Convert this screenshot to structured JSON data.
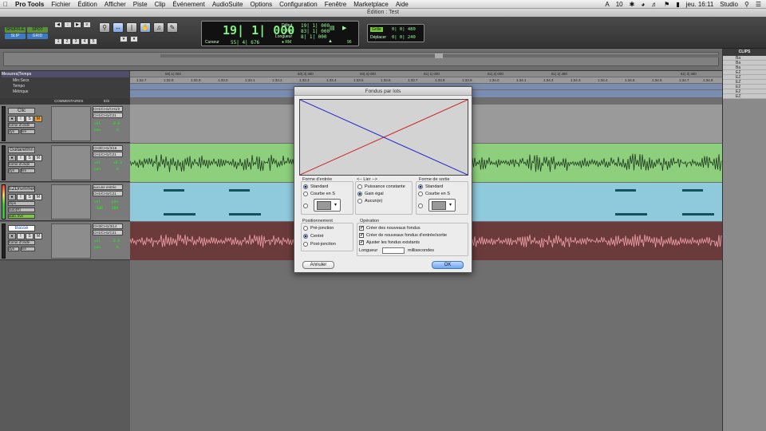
{
  "menubar": {
    "apple": "",
    "app": "Pro Tools",
    "items": [
      "Fichier",
      "Édition",
      "Afficher",
      "Piste",
      "Clip",
      "Événement",
      "AudioSuite",
      "Options",
      "Configuration",
      "Fenêtre",
      "Marketplace",
      "Aide"
    ],
    "status_num": "10",
    "clock": "jeu. 16:11",
    "user": "Studio"
  },
  "window": {
    "title": "Édition : Test"
  },
  "toolbar": {
    "modes": [
      "SHUFFLE",
      "SPOT",
      "SLIP",
      "GRID"
    ],
    "numbers": [
      "1",
      "2",
      "3",
      "4",
      "5"
    ],
    "counter": {
      "main": "19| 1| 000",
      "cursor_label": "Curseur",
      "cursor_val": "55| 4| 676",
      "start_label": "Début",
      "start_val": "19| 1| 000",
      "end_label": "Fin",
      "end_val": "83| 1| 000",
      "length_label": "Longueur",
      "length_val": "8| 1| 000",
      "tempo": "96"
    },
    "grid": {
      "grid_label": "Grille",
      "grid_val": "0| 0| 480",
      "nudge_label": "Déplacer",
      "nudge_val": "0| 0| 240"
    }
  },
  "rulers": {
    "labels": [
      "Mesures|Temps",
      "Min:Secs",
      "Tempo",
      "Métrique"
    ],
    "bar_ticks": [
      "50| 1| 000",
      "50| 3| 480",
      "50| 4| 000",
      "51| 1| 000",
      "51| 2| 000",
      "51| 2| 480",
      "51| 3| 480"
    ],
    "time_ticks": [
      "1:32.7",
      "1:32.8",
      "1:32.9",
      "1:33.0",
      "1:33.1",
      "1:33.2",
      "1:33.3",
      "1:33.4",
      "1:33.5",
      "1:33.6",
      "1:33.7",
      "1:33.8",
      "1:33.9",
      "1:34.0",
      "1:34.1",
      "1:34.2",
      "1:34.3",
      "1:34.4",
      "1:34.5",
      "1:34.6",
      "1:34.7",
      "1:34.8"
    ]
  },
  "columns": {
    "comments": "COMMENTAIRES",
    "io": "E/S"
  },
  "tracks": [
    {
      "name": "Clic",
      "io1": "CH1/CH1/CH1/2",
      "io2": "CH1/CH1/C21",
      "view": "forme d'onde",
      "dyn": "dyn",
      "mode": "lire",
      "vol_label": "vol",
      "vol": "0.0",
      "pan_label": "pan",
      "pan": "0",
      "color": "#9a9a9a"
    },
    {
      "name": "Guitaretmn",
      "io1": "CH3/CH1/3/16",
      "io2": "CH1/CH1/C21",
      "view": "forme d'onde",
      "dyn": "dyn",
      "mode": "lire",
      "vol_label": "vol",
      "vol": "+0.3",
      "pan_label": "pan",
      "pan": "0",
      "color": "#8dcf7c"
    },
    {
      "name": "EZDrummer",
      "io1": "aucune entrée",
      "io2": "CH1/CH1/C21",
      "view": "clips",
      "dyn": "auto(R)",
      "mode": "auto. live",
      "vol_label": "vol",
      "vol": "-100",
      "pan_label": "pan",
      "pan": "100",
      "color": "#8ec9dc"
    },
    {
      "name": "Basse",
      "io1": "CH3/CH1/3/14",
      "io2": "CH1/CH1/C21",
      "view": "forme d'onde",
      "dyn": "dyn",
      "mode": "lire",
      "vol_label": "vol",
      "vol": "0.0",
      "pan_label": "pan",
      "pan": "0",
      "color": "#6b3b3b"
    }
  ],
  "clips_panel": {
    "title": "CLIPS",
    "items": [
      "Ba",
      "Ba",
      "Ba",
      "EZ",
      "EZ",
      "EZ",
      "E2",
      "E2",
      "EZ"
    ]
  },
  "dialog": {
    "title": "Fondus par lots",
    "fade_in": {
      "title": "Forme d'entrée",
      "opt1": "Standard",
      "opt2": "Courbe en S"
    },
    "link": {
      "title": "<-- Lier -->",
      "opt1": "Puissance constante",
      "opt2": "Gain égal",
      "opt3": "Aucun(e)"
    },
    "fade_out": {
      "title": "Forme de sortie",
      "opt1": "Standard",
      "opt2": "Courbe en S"
    },
    "position": {
      "title": "Positionnement",
      "opt1": "Pré-jonction",
      "opt2": "Centré",
      "opt3": "Post-jonction"
    },
    "operation": {
      "title": "Opération",
      "c1": "Créer des nouveaux fondus",
      "c2": "Créer de nouveaux fondus d'entrée/sortie",
      "c3": "Ajuster les fondus existants",
      "length_label": "Longueur",
      "length_value": "",
      "ms": "millisecondes"
    },
    "cancel": "Annuler",
    "ok": "OK"
  },
  "colors": {
    "fade_in": "#cc2222",
    "fade_out": "#2222cc",
    "accent": "#6ea6f0"
  }
}
